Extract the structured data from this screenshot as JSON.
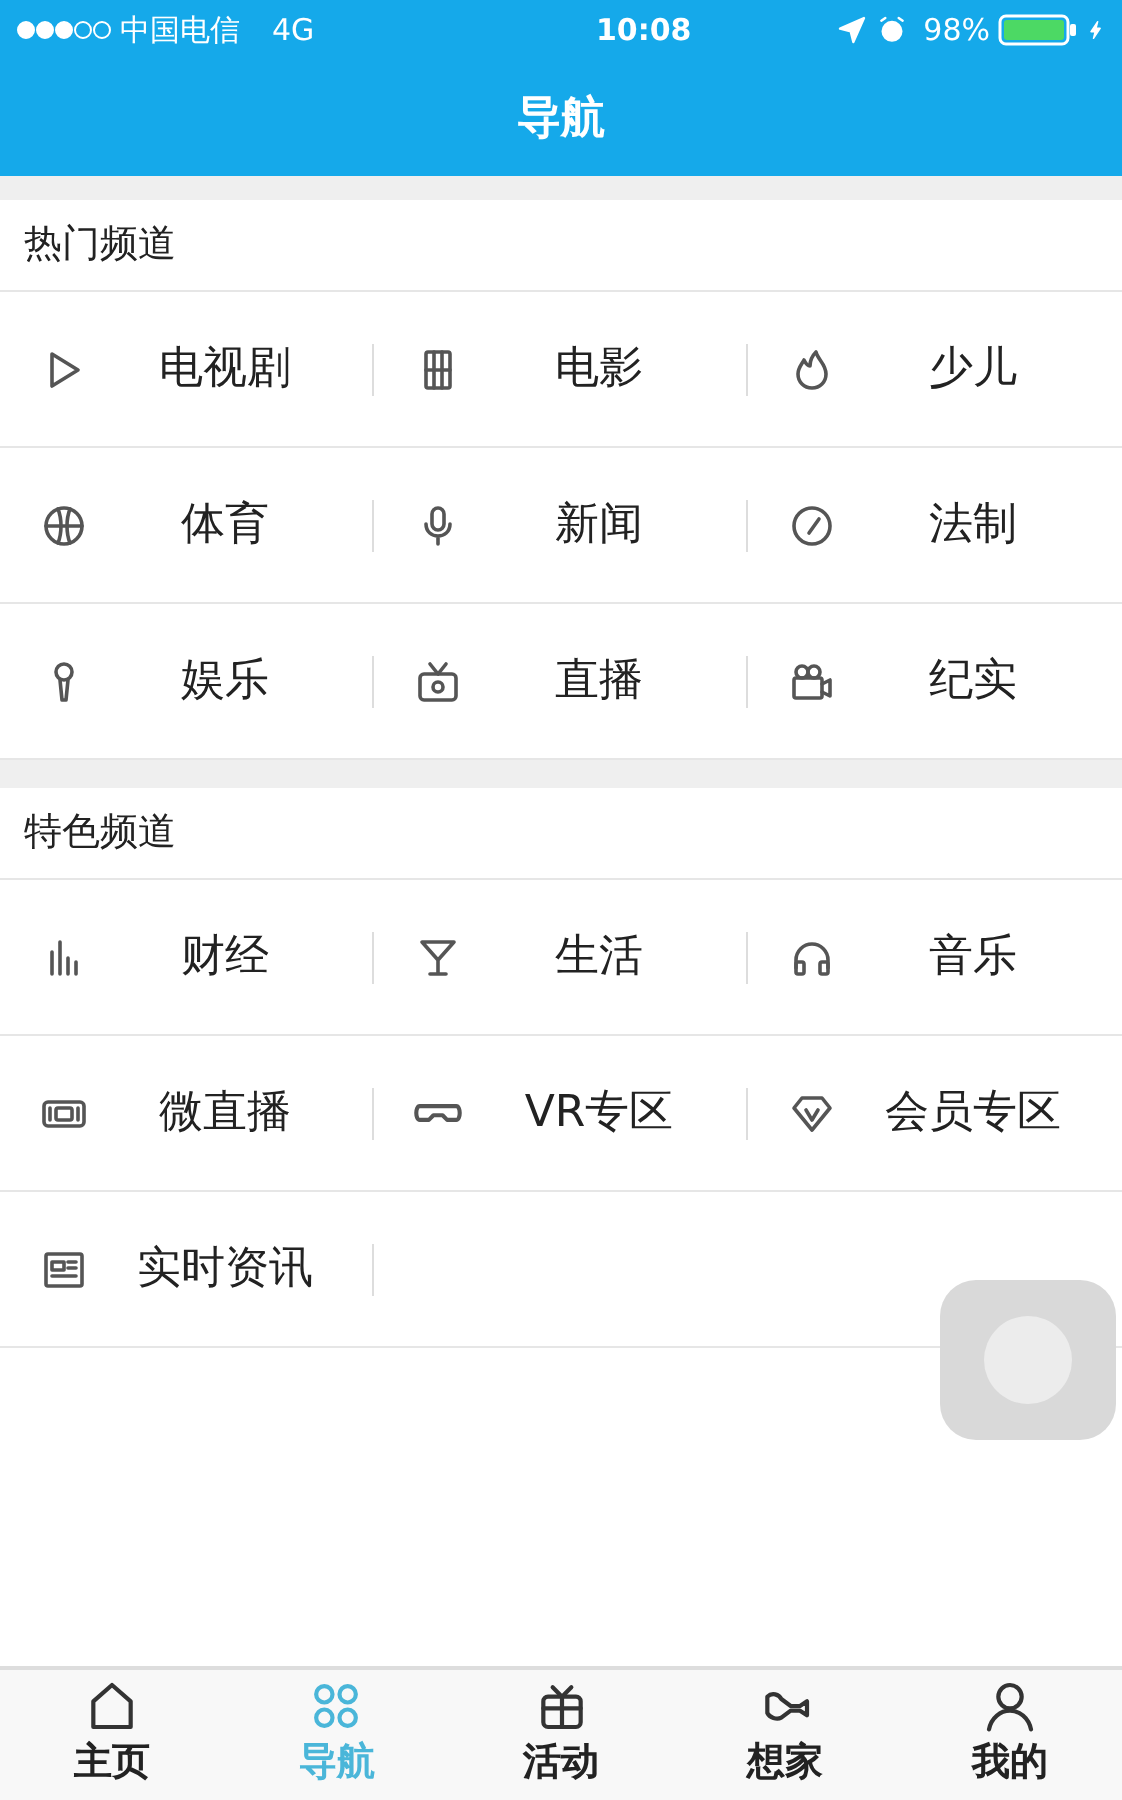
{
  "status_bar": {
    "carrier": "中国电信",
    "network": "4G",
    "time": "10:08",
    "battery": "98%"
  },
  "header": {
    "title": "导航"
  },
  "sections": [
    {
      "title": "热门频道",
      "items": [
        {
          "label": "电视剧"
        },
        {
          "label": "电影"
        },
        {
          "label": "少儿"
        },
        {
          "label": "体育"
        },
        {
          "label": "新闻"
        },
        {
          "label": "法制"
        },
        {
          "label": "娱乐"
        },
        {
          "label": "直播"
        },
        {
          "label": "纪实"
        }
      ]
    },
    {
      "title": "特色频道",
      "items": [
        {
          "label": "财经"
        },
        {
          "label": "生活"
        },
        {
          "label": "音乐"
        },
        {
          "label": "微直播"
        },
        {
          "label": "VR专区"
        },
        {
          "label": "会员专区"
        },
        {
          "label": "实时资讯"
        }
      ]
    }
  ],
  "tab_bar": [
    {
      "label": "主页",
      "selected": false
    },
    {
      "label": "导航",
      "selected": true
    },
    {
      "label": "活动",
      "selected": false
    },
    {
      "label": "想家",
      "selected": false
    },
    {
      "label": "我的",
      "selected": false
    }
  ]
}
